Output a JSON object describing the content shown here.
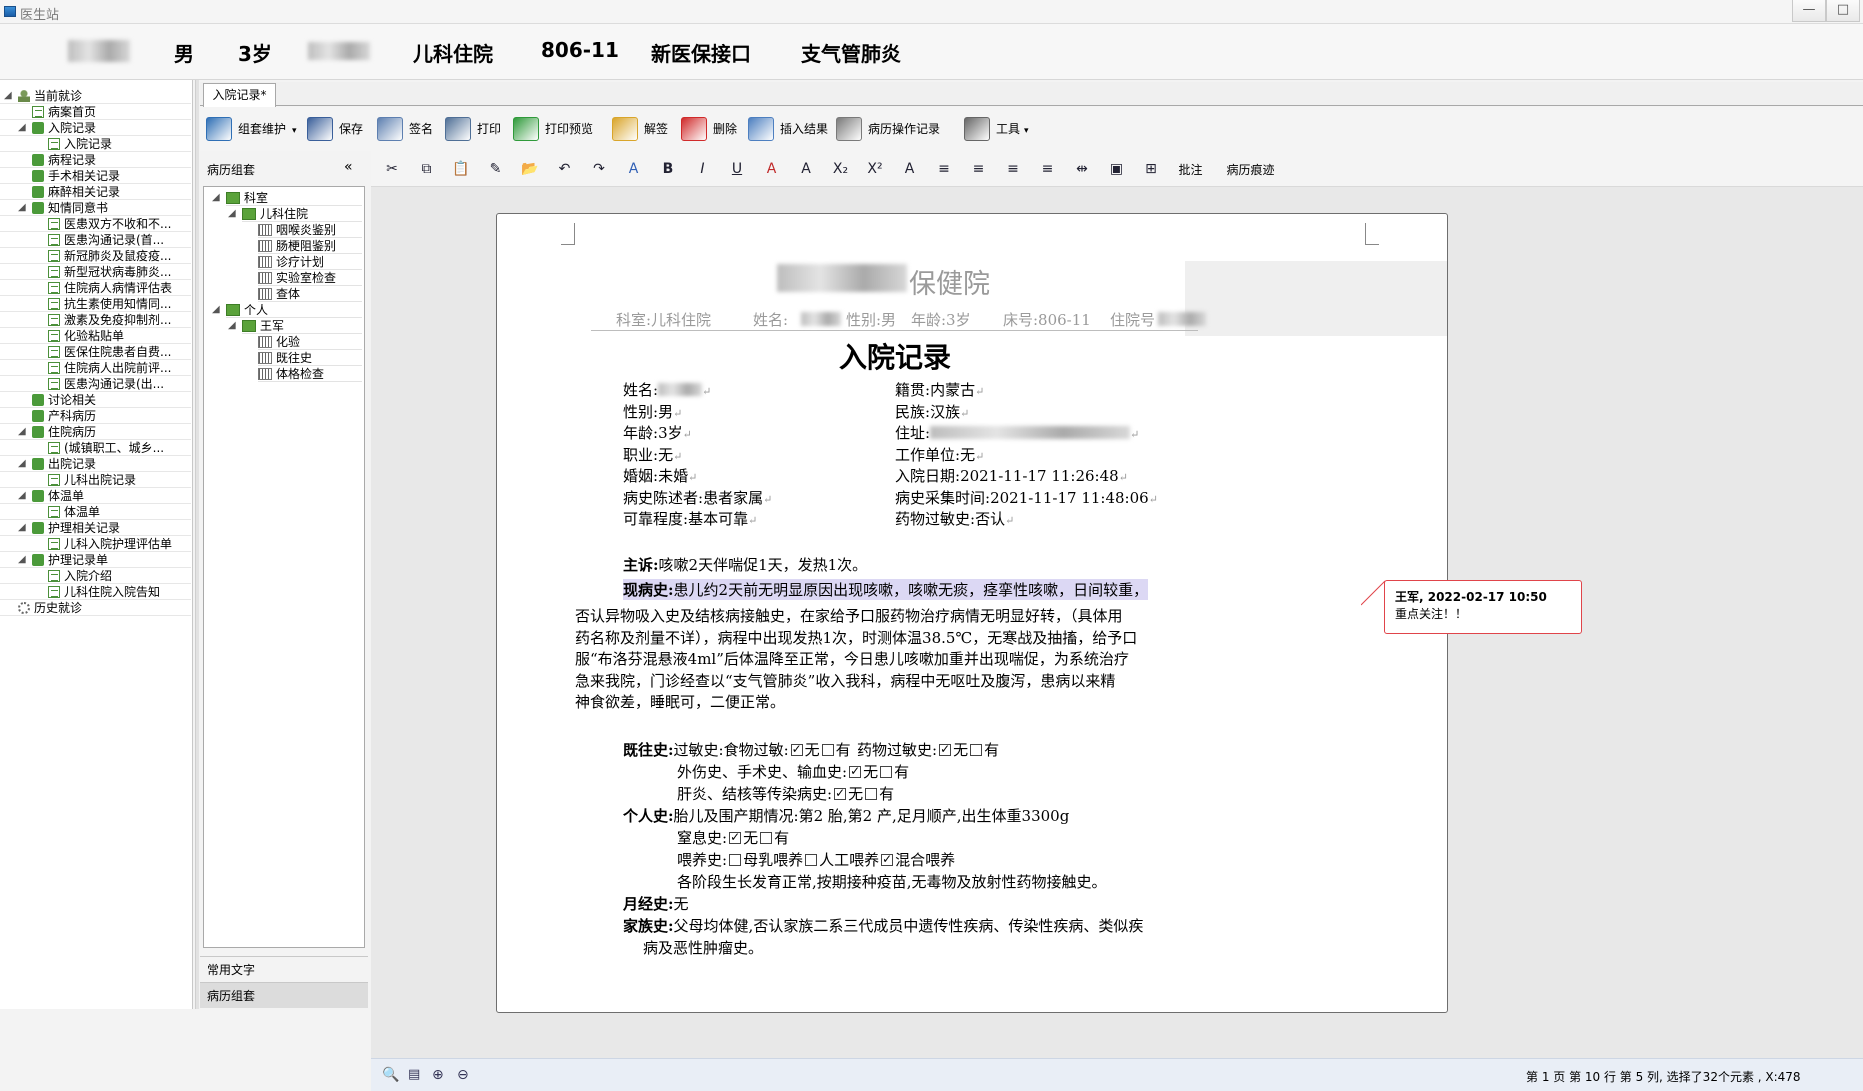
{
  "window": {
    "title": "医生站",
    "minimize": "—",
    "maximize": "□"
  },
  "patient": {
    "gender": "男",
    "age": "3岁",
    "dept": "儿科住院",
    "bed": "806-11",
    "insurance": "新医保接口",
    "diagnosis": "支气管肺炎"
  },
  "leftnav": {
    "items": [
      {
        "label": "当前就诊",
        "level": 0,
        "exp": "◢",
        "icon": "person-icon"
      },
      {
        "label": "病案首页",
        "level": 1,
        "exp": "",
        "icon": "doc-icon"
      },
      {
        "label": "入院记录",
        "level": 1,
        "exp": "◢",
        "icon": "folder-icon"
      },
      {
        "label": "入院记录",
        "level": 2,
        "exp": "",
        "icon": "doc-icon"
      },
      {
        "label": "病程记录",
        "level": 1,
        "exp": "",
        "icon": "folder-icon"
      },
      {
        "label": "手术相关记录",
        "level": 1,
        "exp": "",
        "icon": "folder-icon"
      },
      {
        "label": "麻醉相关记录",
        "level": 1,
        "exp": "",
        "icon": "folder-icon"
      },
      {
        "label": "知情同意书",
        "level": 1,
        "exp": "◢",
        "icon": "folder-icon"
      },
      {
        "label": "医患双方不收和不...",
        "level": 2,
        "exp": "",
        "icon": "doc-icon"
      },
      {
        "label": "医患沟通记录(首...",
        "level": 2,
        "exp": "",
        "icon": "doc-icon"
      },
      {
        "label": "新冠肺炎及鼠疫疫...",
        "level": 2,
        "exp": "",
        "icon": "doc-icon"
      },
      {
        "label": "新型冠状病毒肺炎...",
        "level": 2,
        "exp": "",
        "icon": "doc-icon"
      },
      {
        "label": "住院病人病情评估表",
        "level": 2,
        "exp": "",
        "icon": "doc-icon"
      },
      {
        "label": "抗生素使用知情同...",
        "level": 2,
        "exp": "",
        "icon": "doc-icon"
      },
      {
        "label": "激素及免疫抑制剂...",
        "level": 2,
        "exp": "",
        "icon": "doc-icon"
      },
      {
        "label": "化验粘贴单",
        "level": 2,
        "exp": "",
        "icon": "doc-icon"
      },
      {
        "label": "医保住院患者自费...",
        "level": 2,
        "exp": "",
        "icon": "doc-icon"
      },
      {
        "label": "住院病人出院前评...",
        "level": 2,
        "exp": "",
        "icon": "doc-icon"
      },
      {
        "label": "医患沟通记录(出...",
        "level": 2,
        "exp": "",
        "icon": "doc-icon"
      },
      {
        "label": "讨论相关",
        "level": 1,
        "exp": "",
        "icon": "folder-icon"
      },
      {
        "label": "产科病历",
        "level": 1,
        "exp": "",
        "icon": "folder-icon"
      },
      {
        "label": "住院病历",
        "level": 1,
        "exp": "◢",
        "icon": "folder-icon"
      },
      {
        "label": "(城镇职工、城乡...",
        "level": 2,
        "exp": "",
        "icon": "doc-icon"
      },
      {
        "label": "出院记录",
        "level": 1,
        "exp": "◢",
        "icon": "folder-icon"
      },
      {
        "label": "儿科出院记录",
        "level": 2,
        "exp": "",
        "icon": "doc-icon"
      },
      {
        "label": "体温单",
        "level": 1,
        "exp": "◢",
        "icon": "folder-icon"
      },
      {
        "label": "体温单",
        "level": 2,
        "exp": "",
        "icon": "doc-icon"
      },
      {
        "label": "护理相关记录",
        "level": 1,
        "exp": "◢",
        "icon": "folder-icon"
      },
      {
        "label": "儿科入院护理评估单",
        "level": 2,
        "exp": "",
        "icon": "doc-icon"
      },
      {
        "label": "护理记录单",
        "level": 1,
        "exp": "◢",
        "icon": "folder-icon"
      },
      {
        "label": "入院介绍",
        "level": 2,
        "exp": "",
        "icon": "doc-icon"
      },
      {
        "label": "儿科住院入院告知",
        "level": 2,
        "exp": "",
        "icon": "doc-icon"
      },
      {
        "label": "历史就诊",
        "level": 0,
        "exp": "",
        "icon": "history-icon"
      }
    ]
  },
  "midpanel": {
    "title": "病历组套",
    "collapse": "«",
    "tree": [
      {
        "label": "科室",
        "level": 0,
        "exp": "◢",
        "kind": "folder"
      },
      {
        "label": "儿科住院",
        "level": 1,
        "exp": "◢",
        "kind": "folder"
      },
      {
        "label": "咽喉炎鉴别",
        "level": 2,
        "exp": "",
        "kind": "item"
      },
      {
        "label": "肠梗阻鉴别",
        "level": 2,
        "exp": "",
        "kind": "item"
      },
      {
        "label": "诊疗计划",
        "level": 2,
        "exp": "",
        "kind": "item"
      },
      {
        "label": "实验室检查",
        "level": 2,
        "exp": "",
        "kind": "item"
      },
      {
        "label": "查体",
        "level": 2,
        "exp": "",
        "kind": "item"
      },
      {
        "label": "个人",
        "level": 0,
        "exp": "◢",
        "kind": "folder"
      },
      {
        "label": "王军",
        "level": 1,
        "exp": "◢",
        "kind": "folder"
      },
      {
        "label": "化验",
        "level": 2,
        "exp": "",
        "kind": "item"
      },
      {
        "label": "既往史",
        "level": 2,
        "exp": "",
        "kind": "item"
      },
      {
        "label": "体格检查",
        "level": 2,
        "exp": "",
        "kind": "item"
      }
    ],
    "bottom_tabs": [
      "常用文字",
      "病历组套"
    ]
  },
  "doc_tab": "入院记录*",
  "toolbar": [
    {
      "label": "组套维护",
      "icon": "grid-icon",
      "dropdown": "▾",
      "color": "#2f6fb5"
    },
    {
      "label": "保存",
      "icon": "save-icon",
      "dropdown": "",
      "color": "#3a5f9a"
    },
    {
      "label": "签名",
      "icon": "sign-icon",
      "dropdown": "",
      "color": "#5d7fb0"
    },
    {
      "label": "打印",
      "icon": "print-icon",
      "dropdown": "",
      "color": "#4f6f96"
    },
    {
      "label": "打印预览",
      "icon": "print-preview-icon",
      "dropdown": "",
      "color": "#2f9a3a"
    },
    {
      "label": "解签",
      "icon": "unsign-icon",
      "dropdown": "",
      "color": "#d9a52a"
    },
    {
      "label": "删除",
      "icon": "delete-icon",
      "dropdown": "",
      "color": "#d02a2a"
    },
    {
      "label": "插入结果",
      "icon": "insert-result-icon",
      "dropdown": "",
      "color": "#4d7fc0"
    },
    {
      "label": "病历操作记录",
      "icon": "history-log-icon",
      "dropdown": "",
      "color": "#7a7a7a"
    },
    {
      "label": "工具",
      "icon": "tools-icon",
      "dropdown": "▾",
      "color": "#666666"
    }
  ],
  "format_bar": {
    "buttons": [
      {
        "glyph": "✂",
        "name": "cut-icon"
      },
      {
        "glyph": "⧉",
        "name": "copy-icon"
      },
      {
        "glyph": "📋",
        "name": "paste-icon"
      },
      {
        "glyph": "✎",
        "name": "format-painter-icon"
      },
      {
        "glyph": "📂",
        "name": "open-icon"
      },
      {
        "glyph": "↶",
        "name": "undo-icon"
      },
      {
        "glyph": "↷",
        "name": "redo-icon"
      },
      {
        "glyph": "A",
        "name": "font-icon"
      },
      {
        "glyph": "B",
        "name": "bold-icon"
      },
      {
        "glyph": "I",
        "name": "italic-icon"
      },
      {
        "glyph": "U",
        "name": "underline-icon"
      },
      {
        "glyph": "A",
        "name": "font-color-icon"
      },
      {
        "glyph": "A",
        "name": "highlight-icon"
      },
      {
        "glyph": "X₂",
        "name": "subscript-icon"
      },
      {
        "glyph": "X²",
        "name": "superscript-icon"
      },
      {
        "glyph": "A",
        "name": "clear-format-icon"
      },
      {
        "glyph": "≡",
        "name": "align-left-icon"
      },
      {
        "glyph": "≡",
        "name": "align-center-icon"
      },
      {
        "glyph": "≡",
        "name": "align-right-icon"
      },
      {
        "glyph": "≡",
        "name": "justify-icon"
      },
      {
        "glyph": "⇹",
        "name": "line-spacing-icon"
      },
      {
        "glyph": "▣",
        "name": "table-icon"
      },
      {
        "glyph": "⊞",
        "name": "insert-element-icon"
      }
    ],
    "comment_label": "批注",
    "trace_label": "病历痕迹"
  },
  "document": {
    "hospital": "保健院",
    "header_line": {
      "dept": "科室:儿科住院",
      "name": "姓名:",
      "sex": "性别:男",
      "age": "年龄:3岁",
      "bed": "床号:806-11",
      "hosp_no": "住院号"
    },
    "title": "入院记录",
    "fields": [
      {
        "l": "姓名:",
        "v": "",
        "blur": true,
        "col": 0,
        "row": 0
      },
      {
        "l": "籍贯:",
        "v": "内蒙古",
        "col": 1,
        "row": 0
      },
      {
        "l": "性别:",
        "v": "男",
        "col": 0,
        "row": 1
      },
      {
        "l": "民族:",
        "v": "汉族",
        "col": 1,
        "row": 1
      },
      {
        "l": "年龄:",
        "v": "3岁",
        "col": 0,
        "row": 2
      },
      {
        "l": "住址:",
        "v": "",
        "blur": true,
        "col": 1,
        "row": 2
      },
      {
        "l": "职业:",
        "v": "无",
        "col": 0,
        "row": 3
      },
      {
        "l": "工作单位:",
        "v": "无",
        "col": 1,
        "row": 3
      },
      {
        "l": "婚姻:",
        "v": "未婚",
        "col": 0,
        "row": 4
      },
      {
        "l": "入院日期:",
        "v": "2021-11-17 11:26:48",
        "col": 1,
        "row": 4
      },
      {
        "l": "病史陈述者:",
        "v": "患者家属",
        "col": 0,
        "row": 5
      },
      {
        "l": "病史采集时间:",
        "v": "2021-11-17 11:48:06",
        "col": 1,
        "row": 5
      },
      {
        "l": "可靠程度:",
        "v": "基本可靠",
        "col": 0,
        "row": 6
      },
      {
        "l": "药物过敏史:",
        "v": "否认",
        "col": 1,
        "row": 6
      }
    ],
    "chief_label": "主诉:",
    "chief": "咳嗽2天伴喘促1天，发热1次。",
    "hpi_label": "现病史:",
    "hpi_highlight": "患儿约2天前无明显原因出现咳嗽，咳嗽无痰，痉挛性咳嗽，日间较重，",
    "hpi_lines": [
      "否认异物吸入史及结核病接触史，在家给予口服药物治疗病情无明显好转，（具体用",
      "药名称及剂量不详），病程中出现发热1次，时测体温38.5℃，无寒战及抽搐，给予口",
      "服“布洛芬混悬液4ml”后体温降至正常，今日患儿咳嗽加重并出现喘促，为系统治疗",
      "急来我院，门诊经查以“支气管肺炎”收入我科，病程中无呕吐及腹泻，患病以来精",
      "神食欲差，睡眠可，二便正常。"
    ],
    "past_label": "既往史:",
    "past_allergy": "过敏史:食物过敏:",
    "drug_allergy": "药物过敏史:",
    "trauma": "外伤史、手术史、输血史:",
    "infect": "肝炎、结核等传染病史:",
    "personal_label": "个人史:",
    "birth": "胎儿及围产期情况:第2 胎,第2 产,足月顺产,出生体重3300g",
    "asphyxia": "窒息史:",
    "feeding": "喂养史:",
    "feed_breast": "母乳喂养",
    "feed_artificial": "人工喂养",
    "feed_mixed": "混合喂养",
    "growth": "各阶段生长发育正常,按期接种疫苗,无毒物及放射性药物接触史。",
    "menses_label": "月经史:",
    "menses": "无",
    "family_label": "家族史:",
    "family_1": "父母均体健,否认家族二系三代成员中遗传性疾病、传染性疾病、类似疾",
    "family_2": "病及恶性肿瘤史。",
    "none": "无",
    "has": "有"
  },
  "comment": {
    "author_time": "王军, 2022-02-17 10:50",
    "text": "重点关注！！"
  },
  "status": "第 1 页 第 10 行 第 5 列, 选择了32个元素 , X:478",
  "colors": {
    "highlight": "#dcd8f4",
    "comment_border": "#e0444a",
    "accent": "#2f6fb5"
  }
}
